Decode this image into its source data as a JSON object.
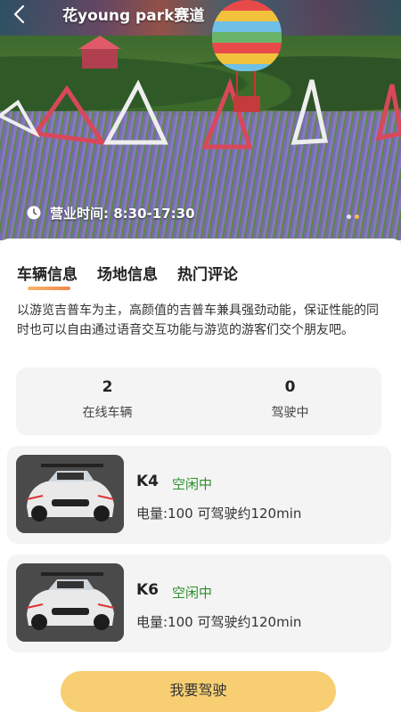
{
  "header": {
    "title": "花young park赛道"
  },
  "hero": {
    "hours_text": "营业时间: 8:30-17:30",
    "dots_count": 2
  },
  "tabs": [
    {
      "label": "车辆信息",
      "active": true
    },
    {
      "label": "场地信息",
      "active": false
    },
    {
      "label": "热门评论",
      "active": false
    }
  ],
  "description": "以游览吉普车为主，高颜值的吉普车兼具强劲动能，保证性能的同时也可以自由通过语音交互功能与游览的游客们交个朋友吧。",
  "stats": [
    {
      "value": "2",
      "label": "在线车辆"
    },
    {
      "value": "0",
      "label": "驾驶中"
    }
  ],
  "cars": [
    {
      "name": "K4",
      "status": "空闲中",
      "info": "电量:100  可驾驶约120min"
    },
    {
      "name": "K6",
      "status": "空闲中",
      "info": "电量:100  可驾驶约120min"
    }
  ],
  "action": {
    "label": "我要驾驶"
  },
  "colors": {
    "accent": "#f7cf72",
    "tab_underline": "#f0874f",
    "status_green": "#2a8f2a"
  }
}
